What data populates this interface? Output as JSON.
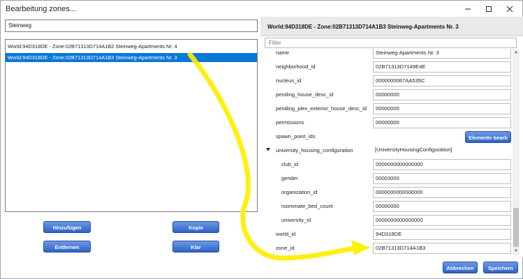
{
  "window": {
    "title": "Bearbeitung zones...",
    "colors": {
      "selection": "#0a78d7",
      "button": "#3c6fd0",
      "annotation": "#ffee00"
    }
  },
  "left": {
    "search_value": "Steinweg",
    "items": [
      "World:94D318DE - Zone:02B71313D714A1B2 Steinweg-Apartments Nr. 4",
      "World:94D318DE - Zone:02B71313D714A1B3 Steinweg-Apartments Nr. 3"
    ],
    "buttons": {
      "add": "Hinzufügen",
      "copy": "Kopie",
      "remove": "Entfernen",
      "clear": "Klar"
    }
  },
  "panel": {
    "header": "World:94D318DE - Zone:02B71313D714A1B3 Steinweg-Apartments Nr. 3",
    "filter_placeholder": "Filter",
    "rows": [
      {
        "name": "name",
        "value": "Steinweg-Apartments Nr. 3"
      },
      {
        "name": "neighborhood_id",
        "value": "02B71313D7149E4E"
      },
      {
        "name": "nucleus_id",
        "value": "0000000087AA535C"
      },
      {
        "name": "pending_house_desc_id",
        "value": "00000000"
      },
      {
        "name": "pending_plex_exterior_house_desc_id",
        "value": "00000000"
      },
      {
        "name": "permissions",
        "value": "00000000"
      },
      {
        "name": "spawn_point_ids",
        "button": "Elemente bearb"
      },
      {
        "name": "university_housing_configuration",
        "value": "[UniversityHousingConfiguration]",
        "expanded": true
      },
      {
        "name": "club_id",
        "value": "0000000000000000"
      },
      {
        "name": "gender",
        "value": "00003000"
      },
      {
        "name": "organization_id",
        "value": "0000000000000000"
      },
      {
        "name": "roommate_bed_count",
        "value": "00000000"
      },
      {
        "name": "university_id",
        "value": "0000000000000000"
      },
      {
        "name": "world_id",
        "value": "94D318DE"
      },
      {
        "name": "zone_id",
        "value": "02B71313D714A1B3"
      }
    ],
    "buttons": {
      "cancel": "Abbrechen",
      "save": "Speichern"
    }
  }
}
